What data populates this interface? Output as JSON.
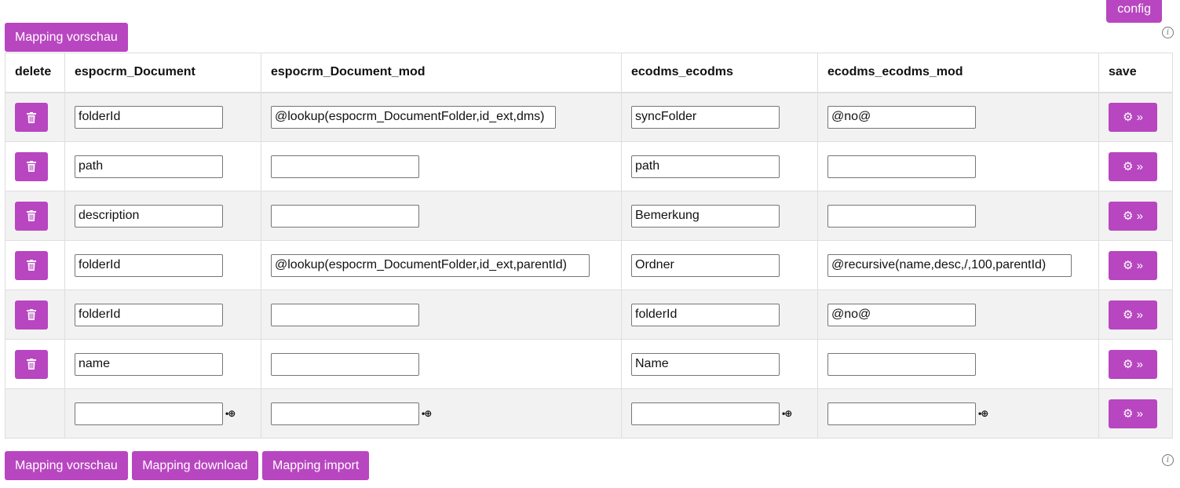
{
  "config_label": "config",
  "info_icon": "info-icon",
  "preview_label": "Mapping vorschau",
  "columns": [
    "delete",
    "espocrm_Document",
    "espocrm_Document_mod",
    "ecodms_ecodms",
    "ecodms_ecodms_mod",
    "save"
  ],
  "rows": [
    {
      "a": "folderId",
      "b": "@lookup(espocrm_DocumentFolder,id_ext,dms)",
      "c": "syncFolder",
      "d": "@no@"
    },
    {
      "a": "path",
      "b": "",
      "c": "path",
      "d": ""
    },
    {
      "a": "description",
      "b": "",
      "c": "Bemerkung",
      "d": ""
    },
    {
      "a": "folderId",
      "b": "@lookup(espocrm_DocumentFolder,id_ext,parentId)",
      "c": "Ordner",
      "d": "@recursive(name,desc,/,100,parentId)"
    },
    {
      "a": "folderId",
      "b": "",
      "c": "folderId",
      "d": "@no@"
    },
    {
      "a": "name",
      "b": "",
      "c": "Name",
      "d": ""
    }
  ],
  "new_row": {
    "a": "",
    "b": "",
    "c": "",
    "d": ""
  },
  "icons": {
    "delete": "trash-icon",
    "save": "gear-forward-icon",
    "add": "add-circle-icon"
  },
  "colors": {
    "accent": "#b846c0",
    "row_alt": "#f2f2f2"
  },
  "bottom_buttons": {
    "preview": "Mapping vorschau",
    "download": "Mapping download",
    "import": "Mapping import"
  }
}
